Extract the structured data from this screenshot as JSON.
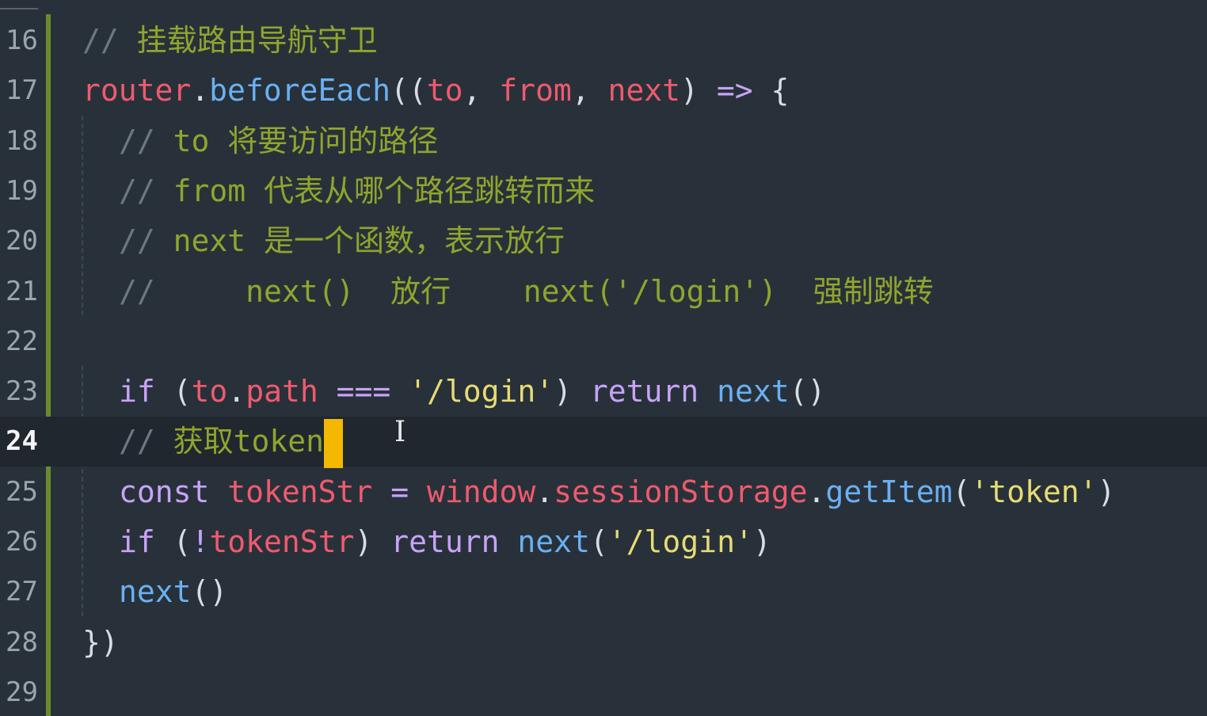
{
  "editor": {
    "active_line": 24,
    "lines": [
      {
        "no": "16",
        "tokens": [
          {
            "t": "// ",
            "c": "cm-slash"
          },
          {
            "t": "挂载路由导航守卫",
            "c": "cm"
          }
        ]
      },
      {
        "no": "17",
        "tokens": [
          {
            "t": "router",
            "c": "red"
          },
          {
            "t": ".",
            "c": "pun"
          },
          {
            "t": "beforeEach",
            "c": "blue"
          },
          {
            "t": "((",
            "c": "pun"
          },
          {
            "t": "to",
            "c": "red"
          },
          {
            "t": ", ",
            "c": "pun"
          },
          {
            "t": "from",
            "c": "red"
          },
          {
            "t": ", ",
            "c": "pun"
          },
          {
            "t": "next",
            "c": "red"
          },
          {
            "t": ") ",
            "c": "pun"
          },
          {
            "t": "=>",
            "c": "kw"
          },
          {
            "t": " {",
            "c": "pun"
          }
        ]
      },
      {
        "no": "18",
        "tokens": [
          {
            "t": "// ",
            "c": "cm-slash"
          },
          {
            "t": "to 将要访问的路径",
            "c": "cm"
          }
        ]
      },
      {
        "no": "19",
        "tokens": [
          {
            "t": "// ",
            "c": "cm-slash"
          },
          {
            "t": "from 代表从哪个路径跳转而来",
            "c": "cm"
          }
        ]
      },
      {
        "no": "20",
        "tokens": [
          {
            "t": "// ",
            "c": "cm-slash"
          },
          {
            "t": "next 是一个函数，表示放行",
            "c": "cm"
          }
        ]
      },
      {
        "no": "21",
        "tokens": [
          {
            "t": "//     ",
            "c": "cm-slash"
          },
          {
            "t": "next()  放行    next('/login')  强制跳转",
            "c": "cm"
          }
        ]
      },
      {
        "no": "22",
        "tokens": []
      },
      {
        "no": "23",
        "tokens": [
          {
            "t": "if",
            "c": "kw"
          },
          {
            "t": " (",
            "c": "pun"
          },
          {
            "t": "to",
            "c": "red"
          },
          {
            "t": ".",
            "c": "pun"
          },
          {
            "t": "path",
            "c": "red"
          },
          {
            "t": " ",
            "c": "pun"
          },
          {
            "t": "===",
            "c": "kw"
          },
          {
            "t": " ",
            "c": "pun"
          },
          {
            "t": "'/login'",
            "c": "str"
          },
          {
            "t": ") ",
            "c": "pun"
          },
          {
            "t": "return",
            "c": "kw"
          },
          {
            "t": " ",
            "c": "pun"
          },
          {
            "t": "next",
            "c": "blue"
          },
          {
            "t": "()",
            "c": "pun"
          }
        ]
      },
      {
        "no": "24",
        "tokens": [
          {
            "t": "// ",
            "c": "cm-slash"
          },
          {
            "t": "获取token",
            "c": "cm"
          }
        ]
      },
      {
        "no": "25",
        "tokens": [
          {
            "t": "const",
            "c": "kw"
          },
          {
            "t": " ",
            "c": "pun"
          },
          {
            "t": "tokenStr",
            "c": "red"
          },
          {
            "t": " ",
            "c": "pun"
          },
          {
            "t": "=",
            "c": "kw"
          },
          {
            "t": " ",
            "c": "pun"
          },
          {
            "t": "window",
            "c": "red"
          },
          {
            "t": ".",
            "c": "pun"
          },
          {
            "t": "sessionStorage",
            "c": "red"
          },
          {
            "t": ".",
            "c": "pun"
          },
          {
            "t": "getItem",
            "c": "blue"
          },
          {
            "t": "(",
            "c": "pun"
          },
          {
            "t": "'token'",
            "c": "str"
          },
          {
            "t": ")",
            "c": "pun"
          }
        ]
      },
      {
        "no": "26",
        "tokens": [
          {
            "t": "if",
            "c": "kw"
          },
          {
            "t": " (",
            "c": "pun"
          },
          {
            "t": "!",
            "c": "kw"
          },
          {
            "t": "tokenStr",
            "c": "red"
          },
          {
            "t": ") ",
            "c": "pun"
          },
          {
            "t": "return",
            "c": "kw"
          },
          {
            "t": " ",
            "c": "pun"
          },
          {
            "t": "next",
            "c": "blue"
          },
          {
            "t": "(",
            "c": "pun"
          },
          {
            "t": "'/login'",
            "c": "str"
          },
          {
            "t": ")",
            "c": "pun"
          }
        ]
      },
      {
        "no": "27",
        "tokens": [
          {
            "t": "next",
            "c": "blue"
          },
          {
            "t": "()",
            "c": "pun"
          }
        ]
      },
      {
        "no": "28",
        "tokens": [
          {
            "t": "})",
            "c": "pun"
          }
        ]
      },
      {
        "no": "29",
        "tokens": []
      }
    ]
  },
  "colors": {
    "background": "#283139",
    "active_line_bg": "#20272e",
    "comment": "#8fa52e",
    "identifier_red": "#f05a6e",
    "function_blue": "#6ab0f3",
    "keyword_purple": "#c7a3f7",
    "string_yellow": "#e6db74",
    "cursor": "#f5b800",
    "git_modified_bar": "#6a8a2c"
  },
  "icons": {
    "mouse_pointer": "i-beam-cursor-icon"
  }
}
